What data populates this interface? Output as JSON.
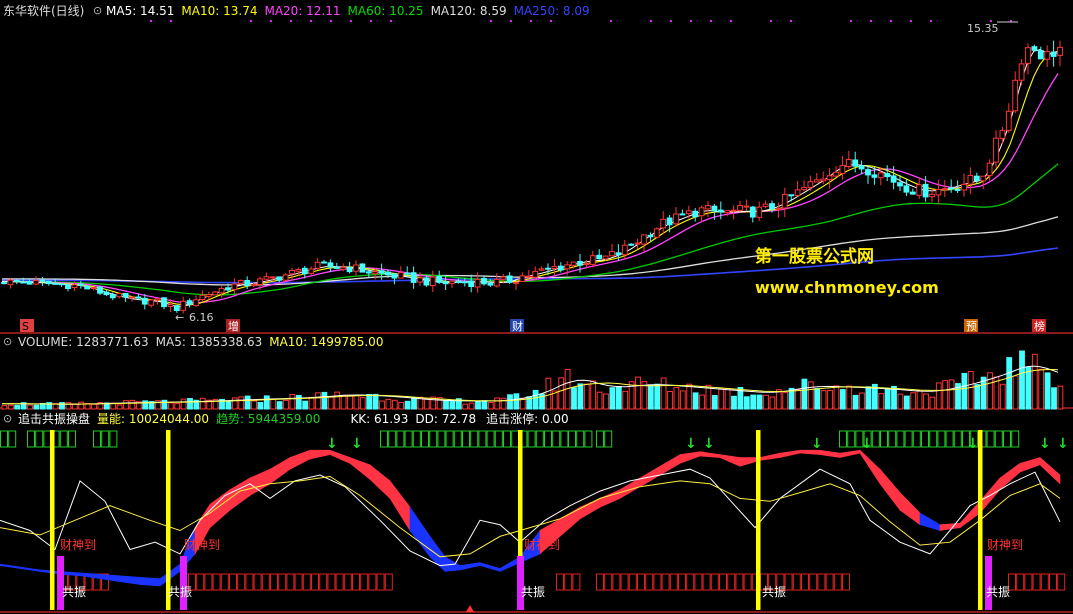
{
  "window_title": "东华软件(日线)",
  "colors": {
    "background": "#000000",
    "divider": "#8b1a1a",
    "ma5": "#ffffff",
    "ma10": "#ffff00",
    "ma20": "#ff44ff",
    "ma60": "#00cc00",
    "ma120": "#dddddd",
    "ma250": "#3344ff",
    "up": "#ff3333",
    "down": "#44ffff",
    "trend_hi": "#ff3344",
    "trend_lo": "#1a33ff",
    "signal": "#ffff00",
    "marker": "#dd22ff",
    "arrow": "#22dd22",
    "box": "#22cc22"
  },
  "main_panel": {
    "legend": [
      {
        "label": "MA5: 14.51",
        "color": "#ffffff"
      },
      {
        "label": "MA10: 13.74",
        "color": "#ffff00"
      },
      {
        "label": "MA20: 12.11",
        "color": "#ff44ff"
      },
      {
        "label": "MA60: 10.25",
        "color": "#00dd00"
      },
      {
        "label": "MA120: 8.59",
        "color": "#dddddd"
      },
      {
        "label": "MA250: 8.09",
        "color": "#3344ff"
      }
    ],
    "high_label": "15.35",
    "low_label": "6.16",
    "watermark_cn": "第一股票公式网",
    "watermark_url": "www.chnmoney.com",
    "event_tags": [
      "S",
      "增",
      "财",
      "预",
      "榜"
    ]
  },
  "volume_panel": {
    "legend": [
      {
        "label": "VOLUME: 1283771.63",
        "color": "#dddddd"
      },
      {
        "label": "MA5: 1385338.63",
        "color": "#dddddd"
      },
      {
        "label": "MA10: 1499785.00",
        "color": "#ffff44"
      }
    ]
  },
  "indicator_panel": {
    "legend": [
      {
        "label": "追击共振操盘",
        "color": "#ffffff"
      },
      {
        "label": "量能: 10024044.00",
        "color": "#ffff44"
      },
      {
        "label": "趋势: 5944359.00",
        "color": "#22cc22"
      },
      {
        "label": "KK: 61.93",
        "color": "#ffffff"
      },
      {
        "label": "DD: 72.78",
        "color": "#ffffff"
      },
      {
        "label": "追击涨停: 0.00",
        "color": "#ffffff"
      }
    ],
    "labels": {
      "caishen": "财神到",
      "gongzhen": "共振"
    }
  },
  "chart_data": {
    "type": "candlestick",
    "title": "东华软件(日线)",
    "price_range": [
      6.16,
      15.35
    ],
    "marked_high": 15.35,
    "marked_low": 6.16,
    "ma_latest": {
      "MA5": 14.51,
      "MA10": 13.74,
      "MA20": 12.11,
      "MA60": 10.25,
      "MA120": 8.59,
      "MA250": 8.09
    },
    "volume_latest": {
      "VOLUME": 1283771.63,
      "MA5": 1385338.63,
      "MA10": 1499785.0
    },
    "indicator_latest": {
      "量能": 10024044.0,
      "趋势": 5944359.0,
      "KK": 61.93,
      "DD": 72.78,
      "追击涨停": 0.0
    },
    "close_path": [
      [
        0,
        7.05
      ],
      [
        40,
        7.0
      ],
      [
        80,
        6.9
      ],
      [
        110,
        6.6
      ],
      [
        130,
        6.45
      ],
      [
        155,
        6.4
      ],
      [
        175,
        6.16
      ],
      [
        200,
        6.55
      ],
      [
        230,
        6.9
      ],
      [
        260,
        7.05
      ],
      [
        290,
        7.3
      ],
      [
        320,
        7.55
      ],
      [
        350,
        7.5
      ],
      [
        380,
        7.3
      ],
      [
        410,
        7.15
      ],
      [
        440,
        7.0
      ],
      [
        470,
        7.05
      ],
      [
        500,
        7.0
      ],
      [
        520,
        7.2
      ],
      [
        540,
        7.35
      ],
      [
        560,
        7.55
      ],
      [
        580,
        7.7
      ],
      [
        600,
        7.75
      ],
      [
        620,
        8.0
      ],
      [
        640,
        8.45
      ],
      [
        660,
        8.9
      ],
      [
        680,
        9.15
      ],
      [
        700,
        9.4
      ],
      [
        720,
        9.3
      ],
      [
        740,
        9.35
      ],
      [
        760,
        9.35
      ],
      [
        780,
        9.6
      ],
      [
        800,
        10.0
      ],
      [
        820,
        10.4
      ],
      [
        840,
        10.9
      ],
      [
        860,
        10.85
      ],
      [
        880,
        10.6
      ],
      [
        900,
        10.25
      ],
      [
        920,
        10.0
      ],
      [
        940,
        10.05
      ],
      [
        960,
        10.25
      ],
      [
        980,
        10.4
      ],
      [
        1000,
        11.8
      ],
      [
        1010,
        12.9
      ],
      [
        1020,
        14.3
      ],
      [
        1030,
        14.8
      ],
      [
        1045,
        14.4
      ],
      [
        1060,
        14.7
      ]
    ],
    "volume_path": [
      [
        0,
        0.1
      ],
      [
        60,
        0.09
      ],
      [
        120,
        0.12
      ],
      [
        180,
        0.14
      ],
      [
        240,
        0.18
      ],
      [
        300,
        0.22
      ],
      [
        340,
        0.28
      ],
      [
        380,
        0.24
      ],
      [
        420,
        0.17
      ],
      [
        460,
        0.15
      ],
      [
        500,
        0.16
      ],
      [
        540,
        0.36
      ],
      [
        560,
        0.62
      ],
      [
        600,
        0.4
      ],
      [
        640,
        0.48
      ],
      [
        680,
        0.42
      ],
      [
        720,
        0.36
      ],
      [
        760,
        0.3
      ],
      [
        800,
        0.44
      ],
      [
        840,
        0.42
      ],
      [
        880,
        0.38
      ],
      [
        920,
        0.32
      ],
      [
        960,
        0.48
      ],
      [
        1000,
        0.72
      ],
      [
        1020,
        0.92
      ],
      [
        1040,
        0.68
      ],
      [
        1060,
        0.64
      ]
    ],
    "kk_path": [
      [
        0,
        0.55
      ],
      [
        30,
        0.62
      ],
      [
        55,
        0.75
      ],
      [
        80,
        0.28
      ],
      [
        105,
        0.42
      ],
      [
        130,
        0.75
      ],
      [
        155,
        0.7
      ],
      [
        180,
        0.78
      ],
      [
        200,
        0.55
      ],
      [
        225,
        0.38
      ],
      [
        250,
        0.3
      ],
      [
        270,
        0.4
      ],
      [
        295,
        0.28
      ],
      [
        320,
        0.24
      ],
      [
        345,
        0.32
      ],
      [
        380,
        0.55
      ],
      [
        410,
        0.76
      ],
      [
        440,
        0.86
      ],
      [
        455,
        0.85
      ],
      [
        480,
        0.55
      ],
      [
        500,
        0.58
      ],
      [
        520,
        0.7
      ],
      [
        545,
        0.55
      ],
      [
        570,
        0.45
      ],
      [
        600,
        0.35
      ],
      [
        630,
        0.28
      ],
      [
        660,
        0.24
      ],
      [
        690,
        0.2
      ],
      [
        710,
        0.26
      ],
      [
        735,
        0.45
      ],
      [
        755,
        0.6
      ],
      [
        780,
        0.4
      ],
      [
        800,
        0.3
      ],
      [
        820,
        0.2
      ],
      [
        850,
        0.3
      ],
      [
        870,
        0.55
      ],
      [
        900,
        0.7
      ],
      [
        930,
        0.78
      ],
      [
        950,
        0.62
      ],
      [
        970,
        0.45
      ],
      [
        990,
        0.38
      ],
      [
        1010,
        0.3
      ],
      [
        1035,
        0.22
      ],
      [
        1060,
        0.56
      ]
    ],
    "dd_path": [
      [
        0,
        0.6
      ],
      [
        40,
        0.65
      ],
      [
        75,
        0.55
      ],
      [
        110,
        0.45
      ],
      [
        150,
        0.55
      ],
      [
        180,
        0.62
      ],
      [
        210,
        0.5
      ],
      [
        240,
        0.35
      ],
      [
        270,
        0.3
      ],
      [
        300,
        0.28
      ],
      [
        330,
        0.25
      ],
      [
        360,
        0.38
      ],
      [
        400,
        0.6
      ],
      [
        440,
        0.8
      ],
      [
        470,
        0.78
      ],
      [
        500,
        0.66
      ],
      [
        530,
        0.6
      ],
      [
        560,
        0.54
      ],
      [
        600,
        0.4
      ],
      [
        640,
        0.32
      ],
      [
        680,
        0.28
      ],
      [
        710,
        0.3
      ],
      [
        740,
        0.4
      ],
      [
        770,
        0.42
      ],
      [
        800,
        0.36
      ],
      [
        830,
        0.3
      ],
      [
        860,
        0.38
      ],
      [
        890,
        0.56
      ],
      [
        920,
        0.72
      ],
      [
        950,
        0.7
      ],
      [
        980,
        0.55
      ],
      [
        1010,
        0.38
      ],
      [
        1040,
        0.3
      ],
      [
        1060,
        0.4
      ]
    ],
    "trend_band": [
      [
        0,
        0.85,
        0.86
      ],
      [
        20,
        0.87,
        0.88
      ],
      [
        40,
        0.89,
        0.9
      ],
      [
        60,
        0.9,
        0.92
      ],
      [
        80,
        0.91,
        0.93
      ],
      [
        100,
        0.92,
        0.95
      ],
      [
        120,
        0.93,
        0.97
      ],
      [
        140,
        0.94,
        0.99
      ],
      [
        160,
        0.95,
        1.0
      ],
      [
        180,
        0.85,
        0.9
      ],
      [
        195,
        0.6,
        0.78
      ],
      [
        210,
        0.44,
        0.6
      ],
      [
        230,
        0.34,
        0.48
      ],
      [
        250,
        0.26,
        0.38
      ],
      [
        270,
        0.2,
        0.3
      ],
      [
        290,
        0.12,
        0.2
      ],
      [
        310,
        0.07,
        0.13
      ],
      [
        330,
        0.07,
        0.1
      ],
      [
        350,
        0.12,
        0.16
      ],
      [
        370,
        0.17,
        0.27
      ],
      [
        390,
        0.28,
        0.4
      ],
      [
        410,
        0.46,
        0.62
      ],
      [
        430,
        0.66,
        0.8
      ],
      [
        445,
        0.8,
        0.9
      ],
      [
        460,
        0.86,
        0.89
      ],
      [
        480,
        0.84,
        0.86
      ],
      [
        500,
        0.88,
        0.9
      ],
      [
        520,
        0.8,
        0.84
      ],
      [
        540,
        0.62,
        0.78
      ],
      [
        560,
        0.54,
        0.66
      ],
      [
        580,
        0.46,
        0.54
      ],
      [
        600,
        0.4,
        0.46
      ],
      [
        620,
        0.34,
        0.4
      ],
      [
        640,
        0.26,
        0.32
      ],
      [
        660,
        0.18,
        0.24
      ],
      [
        680,
        0.1,
        0.16
      ],
      [
        700,
        0.08,
        0.11
      ],
      [
        720,
        0.1,
        0.12
      ],
      [
        740,
        0.12,
        0.18
      ],
      [
        760,
        0.12,
        0.14
      ],
      [
        780,
        0.09,
        0.12
      ],
      [
        800,
        0.07,
        0.09
      ],
      [
        820,
        0.07,
        0.1
      ],
      [
        840,
        0.09,
        0.12
      ],
      [
        860,
        0.07,
        0.09
      ],
      [
        880,
        0.2,
        0.3
      ],
      [
        900,
        0.36,
        0.48
      ],
      [
        920,
        0.5,
        0.58
      ],
      [
        940,
        0.58,
        0.62
      ],
      [
        960,
        0.57,
        0.6
      ],
      [
        980,
        0.42,
        0.5
      ],
      [
        1000,
        0.26,
        0.34
      ],
      [
        1020,
        0.16,
        0.22
      ],
      [
        1040,
        0.12,
        0.17
      ],
      [
        1060,
        0.24,
        0.3
      ]
    ],
    "signal_x": [
      52,
      168,
      520,
      758,
      980
    ],
    "marker_x": [
      60,
      183,
      520,
      988
    ]
  }
}
